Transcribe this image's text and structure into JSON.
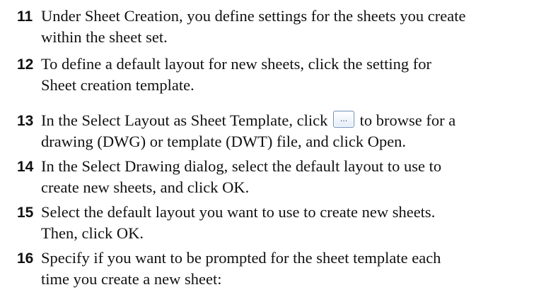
{
  "steps": [
    {
      "number": "11",
      "line1": "Under Sheet Creation, you define settings for the sheets you create",
      "line2": "within the sheet set."
    },
    {
      "number": "12",
      "line1": "To define a default layout for new sheets, click the setting for",
      "line2": "Sheet creation template."
    },
    {
      "number": "13",
      "line1_before_icon": "In the Select Layout as Sheet Template, click",
      "icon": "browse-ellipsis-button",
      "icon_glyph": "...",
      "line1_after_icon": "to browse for a",
      "line2": "drawing (DWG) or template (DWT) file, and click Open."
    },
    {
      "number": "14",
      "line1": "In the Select Drawing dialog, select the default layout to use to",
      "line2": "create new sheets, and click OK."
    },
    {
      "number": "15",
      "line1": "Select the default layout you want to use to create new sheets.",
      "line2": "Then, click OK."
    },
    {
      "number": "16",
      "line1": "Specify if you want to be prompted for the sheet template each",
      "line2": "time you create a new sheet:"
    }
  ]
}
